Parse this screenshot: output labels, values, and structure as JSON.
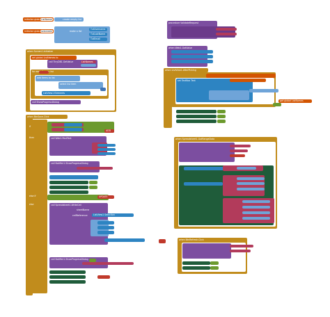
{
  "workspace": {
    "canvas": "Blocks workspace",
    "background": "#ffffff"
  },
  "palette": {
    "variables": "#d35400",
    "procedures": "#7c4ea0",
    "lists": "#6fa4d8",
    "control": "#c18c1c",
    "logic": "#6c9a2e",
    "text": "#b23b5b",
    "math": "#3f73b5",
    "component_blue": "#2d84c2",
    "component_green": "#1f5c3a",
    "component_purple": "#6b3a8a",
    "highlight_red": "#c0392b"
  },
  "blocks": {
    "top_left_global_1": {
      "label_initialize": "initialize global",
      "var_name": "ListNames",
      "create_empty": "create empty list"
    },
    "top_left_global_2": {
      "label_initialize": "initialize global",
      "var_name": "selectedIndex",
      "make_list": "make a list",
      "item1": "TxtUsername",
      "item2": "TxtLastName",
      "item3": "TxtEmail"
    },
    "when_screen_init": {
      "event": "when Screen1.Initialize",
      "do": "do",
      "call_tiny": "call TinyDB1.GetValue",
      "tag": "tag",
      "tag_value": "ListNames",
      "value_if_tag": "valueIfTagNotThere",
      "set_global": "set global ListNames to",
      "for_each": "for each item in list",
      "index": "index",
      "index_label": "index in list",
      "add_items": "add items to list",
      "select_item": "select list item",
      "listview": "ListView1 Elements",
      "call_global": "call ShowProgressDialog"
    },
    "procedure_validate": {
      "header": "procedure ValidateRequest",
      "title": "ShowProgressDialog",
      "message": "Cargando...",
      "notifier": "Notifier1"
    },
    "when_listview_after": {
      "event": "when ListView1.AfterPicking",
      "set_index": "set global selectedIndex to",
      "listview_index": "ListView1 SelectionIndex",
      "for_each_number": "for each number from",
      "from": "from",
      "to": "to",
      "by": "by",
      "set_text": "set TextBox Text",
      "of_component": "of component",
      "to_label": "to",
      "select_list_item": "select list item",
      "list": "list",
      "index2": "index",
      "get_global": "get global ListNames",
      "get_number": "get number",
      "set_enabled": "set BtnDelete Enabled to",
      "set_visible": "set BtnUpdate Visible to",
      "true": "true"
    },
    "when_btnsave": {
      "event": "when BtnSave.Click",
      "if": "if",
      "then": "then",
      "else_if": "else if",
      "else": "else",
      "is_empty": "is empty",
      "and": "and",
      "txt_username": "TxtUsername Text",
      "txt_last": "TxtLastName Text",
      "txt_email": "TxtEmail Text",
      "call_notifier": "call Notifier1.ShowAlert",
      "notice": "notice",
      "call_web": "call Web1.PostText",
      "set_web_url": "set Web1 Url to",
      "join": "join",
      "update": "UPDATE",
      "insert": "INSERT",
      "add": "ADD",
      "listview_selection": "ListView1 Selection",
      "show_progress": "call Notifier1.ShowProgressDialog",
      "message": "message",
      "title": "title",
      "cancelable": "cancelable",
      "write_cell": "call Spreadsheet1.WriteCell",
      "sheet_name": "sheetName",
      "reference": "cellReference",
      "data": "data",
      "sheet1": "Sheet1"
    },
    "when_web_gotvalue": {
      "event": "when Web1.GotValue",
      "get_values": "call Spreadsheet1.ReadRange",
      "sheet_name": "sheetName",
      "range_ref": "rangeReference",
      "sheet_value": "Sheet1",
      "range_value": "A1:C1000"
    },
    "when_spreadsheet_got": {
      "event": "when Spreadsheet1.GotRangeData",
      "set_listview": "set ListView1 Elements to",
      "for_each": "for each item in list",
      "split": "split",
      "at": "at",
      "call_dismiss": "call Notifier1.DismissProgressDialog"
    },
    "when_btn_refresh": {
      "event": "when BtnRefresh.Click",
      "show_dialog": "call Notifier1.ShowProgressDialog",
      "message": "message",
      "title": "title",
      "msg_value": "Cargando datos...",
      "title_value": "Espere"
    }
  }
}
